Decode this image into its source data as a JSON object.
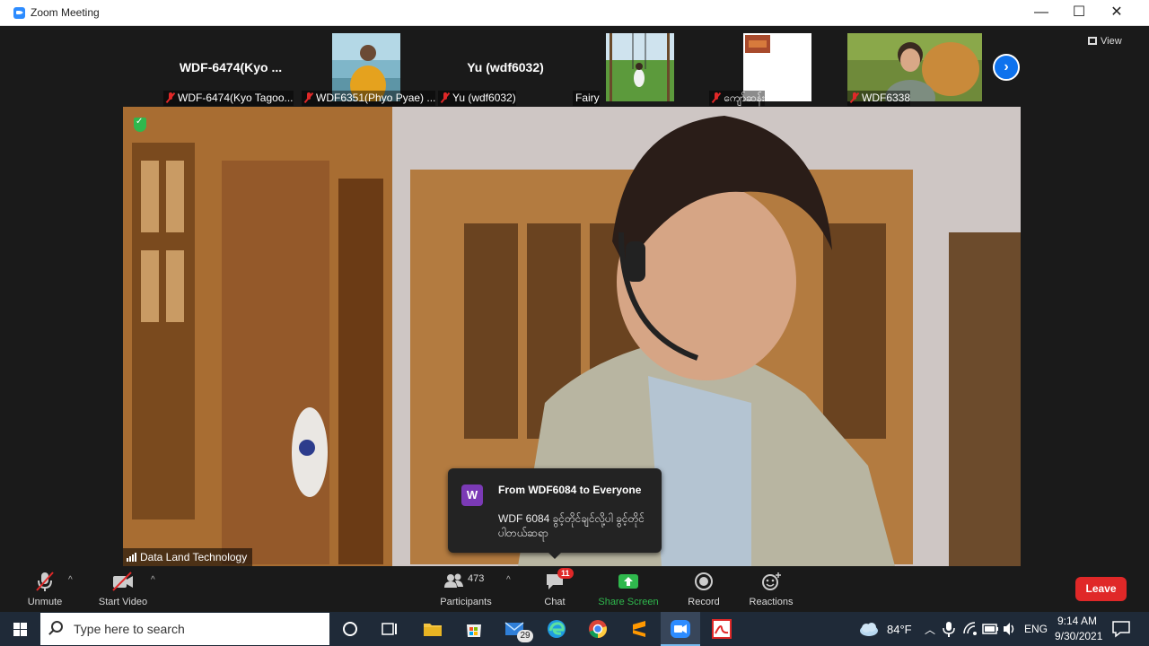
{
  "window": {
    "title": "Zoom Meeting",
    "minimize_glyph": "—",
    "maximize_glyph": "☐",
    "close_glyph": "✕"
  },
  "thumbnails": [
    {
      "display_name": "WDF-6474(Kyo ...",
      "label": "WDF-6474(Kyo Tagoo...",
      "muted": true
    },
    {
      "display_name": "",
      "label": "WDF6351(Phyo Pyae) ...",
      "muted": true
    },
    {
      "display_name": "Yu (wdf6032)",
      "label": "Yu (wdf6032)",
      "muted": true
    },
    {
      "display_name": "",
      "label": "Fairy",
      "muted": false
    },
    {
      "display_name": "",
      "label": "ကျော်ဆန်း",
      "muted": true
    },
    {
      "display_name": "",
      "label": "WDF6338",
      "muted": true
    }
  ],
  "next_page_glyph": "›",
  "view_label": "View",
  "main_video": {
    "name": "Data Land Technology"
  },
  "chat_toast": {
    "avatar_letter": "W",
    "from": "From WDF6084 to Everyone",
    "message": "WDF 6084 ခွင့်တိုင်ချင်လို့ပါ ခွင့်တိုင်ပါတယ်ဆရာ"
  },
  "toolbar": {
    "unmute": "Unmute",
    "start_video": "Start Video",
    "participants": "Participants",
    "participants_count": "473",
    "chat": "Chat",
    "chat_badge": "11",
    "share_screen": "Share Screen",
    "record": "Record",
    "reactions": "Reactions",
    "leave": "Leave",
    "caret": "^"
  },
  "taskbar": {
    "search_placeholder": "Type here to search",
    "mail_badge": "29",
    "weather": "84°F",
    "language": "ENG",
    "time": "9:14 AM",
    "date": "9/30/2021"
  },
  "colors": {
    "accent_blue": "#0e72ed",
    "leave_red": "#e02828",
    "share_green": "#2fb84d",
    "taskbar": "#1f2a38"
  }
}
